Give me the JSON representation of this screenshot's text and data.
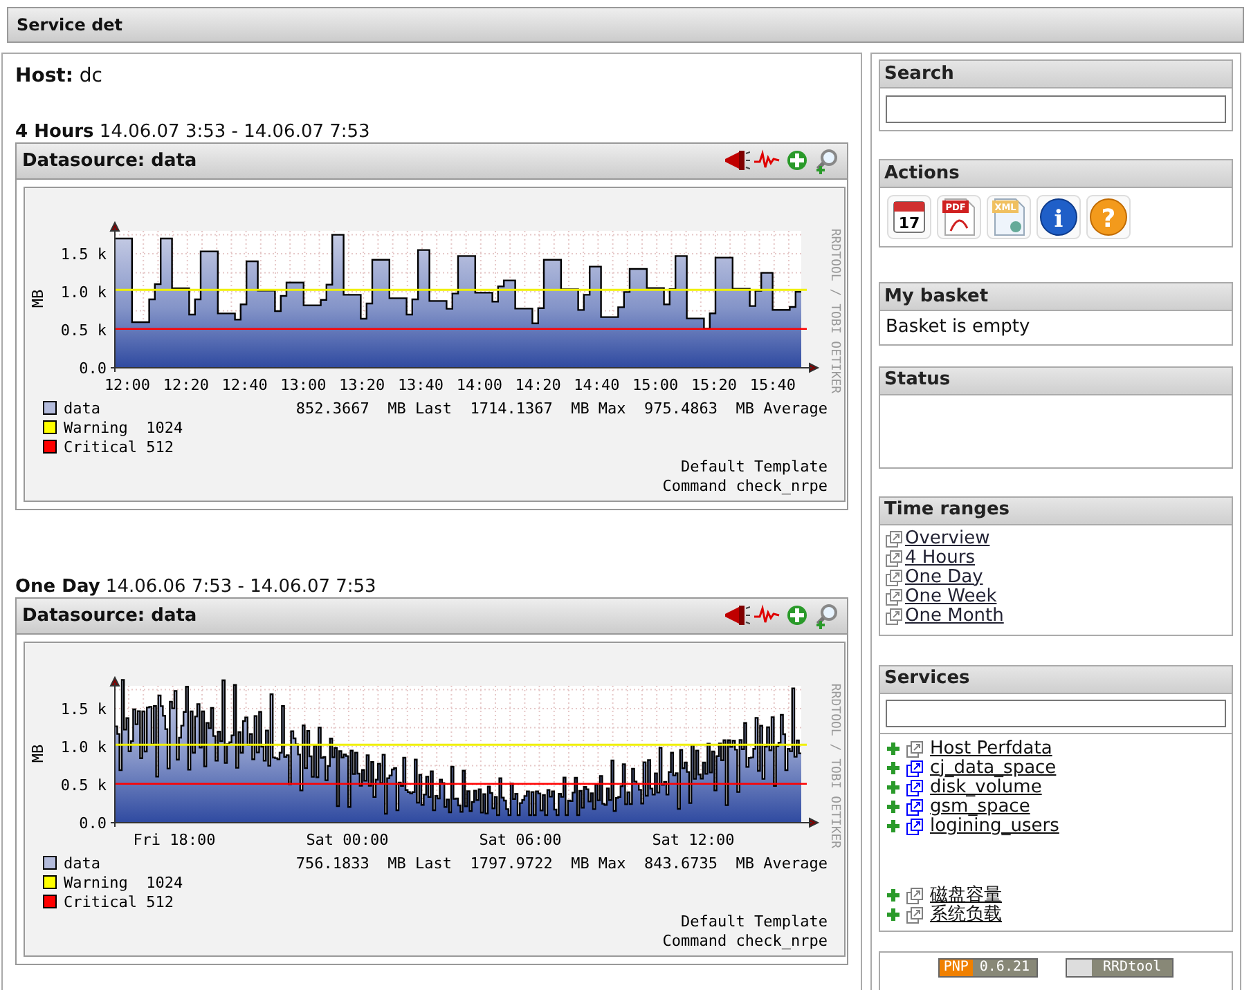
{
  "header": {
    "title": "Service det"
  },
  "host": "**Host:** dc",
  "graphs": [
    {
      "kind": "steps",
      "range": "**4 Hours** 14.06.07 3:53 - 14.06.07 7:53",
      "datasource": "Datasource: data",
      "ylabel": "MB",
      "yticks": [
        "1.5 k",
        "1.0 k",
        "0.5 k",
        "0.0"
      ],
      "xticks": [
        "12:00",
        "12:20",
        "12:40",
        "13:00",
        "13:20",
        "13:40",
        "14:00",
        "14:20",
        "14:40",
        "15:00",
        "15:20",
        "15:40"
      ],
      "legend": [
        {
          "name": "data",
          "color": "#b4bcdc",
          "reading": "852.3667  MB Last  1714.1367  MB Max  975.4863  MB Average"
        },
        {
          "name": "Warning  1024",
          "color": "#ffff00"
        },
        {
          "name": "Critical 512",
          "color": "#ff0000"
        }
      ],
      "footer": [
        "Default Template",
        "Command check_nrpe"
      ],
      "credit": "RRDTOOL / TOBI OETIKER"
    },
    {
      "kind": "noisy",
      "range": "**One Day** 14.06.06 7:53 - 14.06.07 7:53",
      "datasource": "Datasource: data",
      "ylabel": "MB",
      "yticks": [
        "1.5 k",
        "1.0 k",
        "0.5 k",
        "0.0"
      ],
      "xticks": [
        "Fri 18:00",
        "Sat 00:00",
        "Sat 06:00",
        "Sat 12:00"
      ],
      "legend": [
        {
          "name": "data",
          "color": "#b4bcdc",
          "reading": "756.1833  MB Last  1797.9722  MB Max  843.6735  MB Average"
        },
        {
          "name": "Warning  1024",
          "color": "#ffff00"
        },
        {
          "name": "Critical 512",
          "color": "#ff0000"
        }
      ],
      "footer": [
        "Default Template",
        "Command check_nrpe"
      ],
      "credit": "RRDTOOL / TOBI OETIKER"
    }
  ],
  "sidebar": [
    {
      "kind": "search",
      "title": "Search"
    },
    {
      "kind": "actions",
      "title": "Actions",
      "icons": [
        {
          "kind": "calendar",
          "text": "17"
        },
        {
          "kind": "pdf",
          "text": "PDF"
        },
        {
          "kind": "xml",
          "text": "XML"
        },
        {
          "kind": "info",
          "text": "i"
        },
        {
          "kind": "help",
          "text": "?"
        }
      ]
    },
    {
      "kind": "text",
      "title": "My basket",
      "text": "Basket is empty"
    },
    {
      "kind": "blank",
      "title": "Status"
    },
    {
      "kind": "links",
      "title": "Time ranges",
      "links": [
        "Overview",
        "4 Hours",
        "One Day",
        "One Week",
        "One Month"
      ]
    },
    {
      "kind": "services",
      "title": "Services",
      "items": [
        {
          "label": "Host Perfdata",
          "color": "#808080"
        },
        {
          "label": "cj_data_space",
          "color": "#0000ff"
        },
        {
          "label": "disk_volume",
          "color": "#0000ff"
        },
        {
          "label": "gsm_space",
          "color": "#0000ff"
        },
        {
          "label": "logining_users",
          "color": "#0000ff"
        }
      ],
      "more_items": [
        {
          "label": "磁盘容量",
          "color": "#808080"
        },
        {
          "label": "系统负载",
          "color": "#808080"
        }
      ]
    }
  ],
  "badges": [
    {
      "label": "PNP",
      "version": "0.6.21"
    },
    {
      "label": "RRDtool"
    }
  ]
}
